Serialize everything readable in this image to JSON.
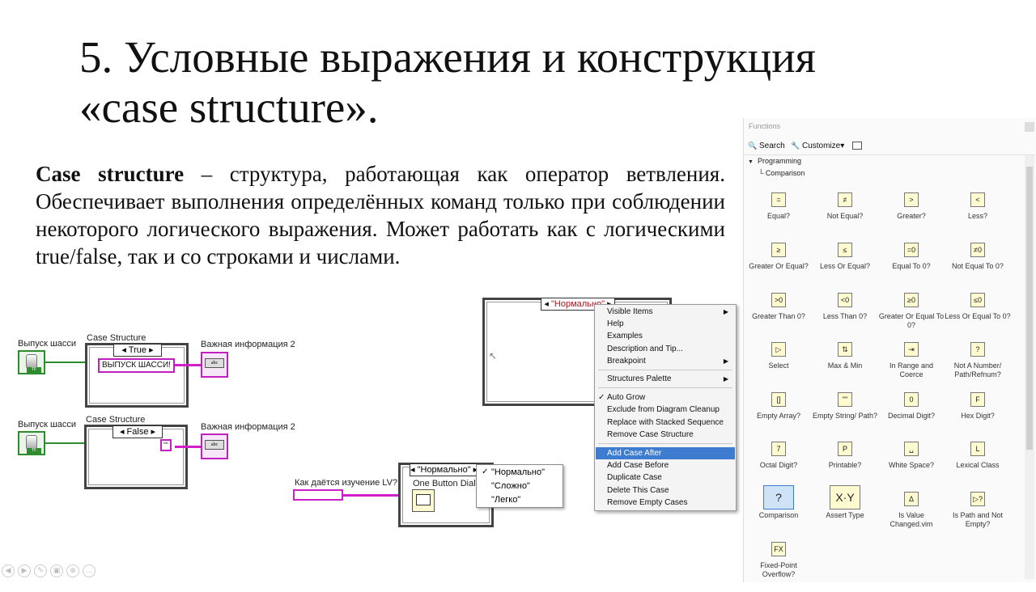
{
  "slide": {
    "title_line1": "5. Условные выражения и конструкция",
    "title_line2": "«case structure».",
    "desc_term": "Case structure",
    "desc_text": " – структура, работающая как оператор ветвления. Обеспечивает выполнения определённых команд только при соблюдении некоторого логического выражения. Может работать как с логическими true/false, так и со строками и числами."
  },
  "diagram": {
    "block1": {
      "control_label": "Выпуск шасси",
      "case_label": "Case Structure",
      "selector": "True",
      "string_const": "ВЫПУСК ШАССИ!",
      "indicator_label": "Важная информация 2"
    },
    "block2": {
      "control_label": "Выпуск шасси",
      "case_label": "Case Structure",
      "selector": "False",
      "string_const": "\"\"",
      "indicator_label": "Важная информация 2"
    },
    "enum_case": {
      "selector": "\"Нормально\"",
      "input_label": "Как даётся изучение LV?",
      "dialog_label": "One Button Dialog"
    },
    "top_case": {
      "selector": "\"Нормально\""
    }
  },
  "enum_popup": {
    "items": [
      "\"Нормально\"",
      "\"Сложно\"",
      "\"Легко\""
    ],
    "checked_index": 0
  },
  "context_menu": {
    "items": [
      {
        "label": "Visible Items",
        "submenu": true
      },
      {
        "label": "Help"
      },
      {
        "label": "Examples"
      },
      {
        "label": "Description and Tip..."
      },
      {
        "label": "Breakpoint",
        "submenu": true
      },
      {
        "label": "Structures Palette",
        "submenu": true
      },
      {
        "label": "Auto Grow",
        "checked": true
      },
      {
        "label": "Exclude from Diagram Cleanup"
      },
      {
        "label": "Replace with Stacked Sequence"
      },
      {
        "label": "Remove Case Structure"
      },
      {
        "label": "Add Case After",
        "selected": true
      },
      {
        "label": "Add Case Before"
      },
      {
        "label": "Duplicate Case"
      },
      {
        "label": "Delete This Case"
      },
      {
        "label": "Remove Empty Cases"
      }
    ]
  },
  "palette": {
    "title": "Functions",
    "search_label": "Search",
    "customize_label": "Customize▾",
    "tree": [
      "Programming",
      "Comparison"
    ],
    "items": [
      {
        "name": "Equal?",
        "icon": "equal-icon",
        "glyph": "="
      },
      {
        "name": "Not Equal?",
        "icon": "not-equal-icon",
        "glyph": "≠"
      },
      {
        "name": "Greater?",
        "icon": "greater-icon",
        "glyph": ">"
      },
      {
        "name": "Less?",
        "icon": "less-icon",
        "glyph": "<"
      },
      {
        "name": "Greater Or Equal?",
        "icon": "greater-equal-icon",
        "glyph": "≥"
      },
      {
        "name": "Less Or Equal?",
        "icon": "less-equal-icon",
        "glyph": "≤"
      },
      {
        "name": "Equal To 0?",
        "icon": "equal-zero-icon",
        "glyph": "=0"
      },
      {
        "name": "Not Equal To 0?",
        "icon": "not-equal-zero-icon",
        "glyph": "≠0"
      },
      {
        "name": "Greater Than 0?",
        "icon": "greater-zero-icon",
        "glyph": ">0"
      },
      {
        "name": "Less Than 0?",
        "icon": "less-zero-icon",
        "glyph": "<0"
      },
      {
        "name": "Greater Or Equal To 0?",
        "icon": "greater-equal-zero-icon",
        "glyph": "≥0"
      },
      {
        "name": "Less Or Equal To 0?",
        "icon": "less-equal-zero-icon",
        "glyph": "≤0"
      },
      {
        "name": "Select",
        "icon": "select-icon",
        "glyph": "▷"
      },
      {
        "name": "Max & Min",
        "icon": "max-min-icon",
        "glyph": "⇅"
      },
      {
        "name": "In Range and Coerce",
        "icon": "in-range-icon",
        "glyph": "⇥"
      },
      {
        "name": "Not A Number/ Path/Refnum?",
        "icon": "nan-icon",
        "glyph": "?"
      },
      {
        "name": "Empty Array?",
        "icon": "empty-array-icon",
        "glyph": "[]"
      },
      {
        "name": "Empty String/ Path?",
        "icon": "empty-string-icon",
        "glyph": "\"\""
      },
      {
        "name": "Decimal Digit?",
        "icon": "decimal-digit-icon",
        "glyph": "0"
      },
      {
        "name": "Hex Digit?",
        "icon": "hex-digit-icon",
        "glyph": "F"
      },
      {
        "name": "Octal Digit?",
        "icon": "octal-digit-icon",
        "glyph": "7"
      },
      {
        "name": "Printable?",
        "icon": "printable-icon",
        "glyph": "P"
      },
      {
        "name": "White Space?",
        "icon": "white-space-icon",
        "glyph": "␣"
      },
      {
        "name": "Lexical Class",
        "icon": "lexical-class-icon",
        "glyph": "L"
      },
      {
        "name": "Comparison",
        "icon": "comparison-icon",
        "glyph": "?"
      },
      {
        "name": "Assert Type",
        "icon": "assert-type-icon",
        "glyph": "X·Y"
      },
      {
        "name": "Is Value Changed.vim",
        "icon": "value-changed-icon",
        "glyph": "Δ"
      },
      {
        "name": "Is Path and Not Empty?",
        "icon": "path-not-empty-icon",
        "glyph": "▷?"
      },
      {
        "name": "Fixed-Point Overflow?",
        "icon": "fixed-point-icon",
        "glyph": "FX"
      }
    ]
  }
}
